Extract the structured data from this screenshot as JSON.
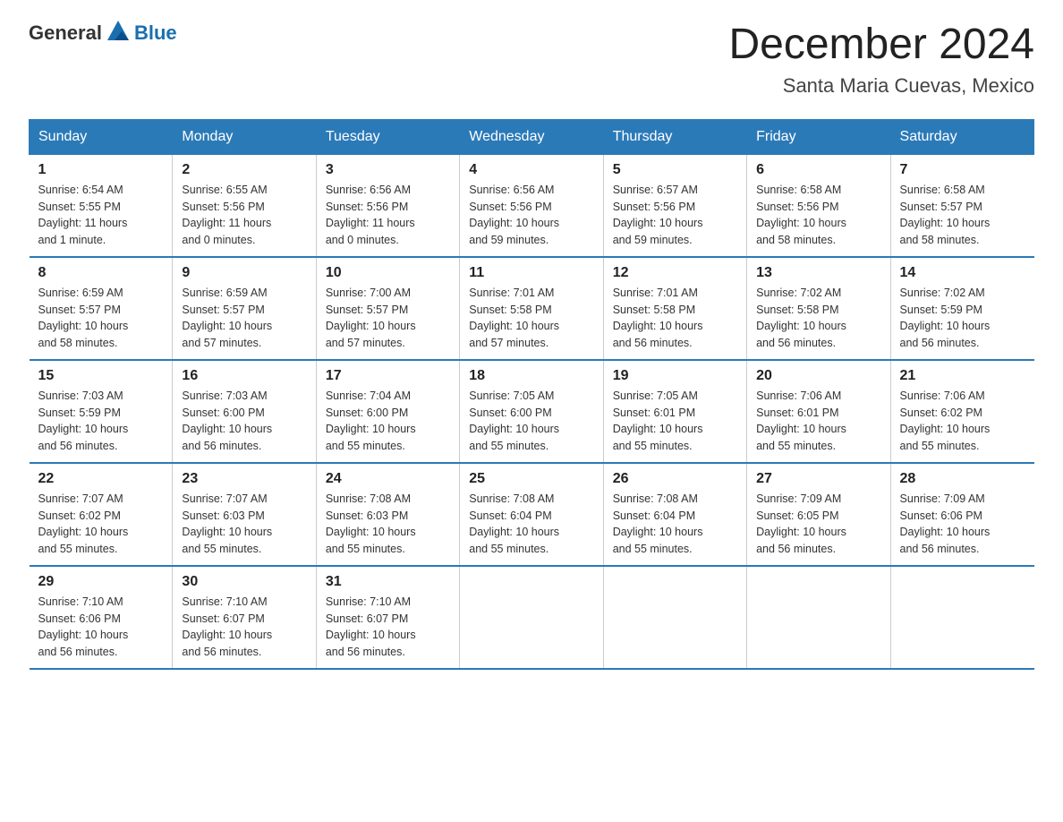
{
  "logo": {
    "general": "General",
    "blue": "Blue"
  },
  "title": "December 2024",
  "location": "Santa Maria Cuevas, Mexico",
  "days_header": [
    "Sunday",
    "Monday",
    "Tuesday",
    "Wednesday",
    "Thursday",
    "Friday",
    "Saturday"
  ],
  "weeks": [
    [
      {
        "day": "1",
        "sunrise": "6:54 AM",
        "sunset": "5:55 PM",
        "daylight": "11 hours and 1 minute."
      },
      {
        "day": "2",
        "sunrise": "6:55 AM",
        "sunset": "5:56 PM",
        "daylight": "11 hours and 0 minutes."
      },
      {
        "day": "3",
        "sunrise": "6:56 AM",
        "sunset": "5:56 PM",
        "daylight": "11 hours and 0 minutes."
      },
      {
        "day": "4",
        "sunrise": "6:56 AM",
        "sunset": "5:56 PM",
        "daylight": "10 hours and 59 minutes."
      },
      {
        "day": "5",
        "sunrise": "6:57 AM",
        "sunset": "5:56 PM",
        "daylight": "10 hours and 59 minutes."
      },
      {
        "day": "6",
        "sunrise": "6:58 AM",
        "sunset": "5:56 PM",
        "daylight": "10 hours and 58 minutes."
      },
      {
        "day": "7",
        "sunrise": "6:58 AM",
        "sunset": "5:57 PM",
        "daylight": "10 hours and 58 minutes."
      }
    ],
    [
      {
        "day": "8",
        "sunrise": "6:59 AM",
        "sunset": "5:57 PM",
        "daylight": "10 hours and 58 minutes."
      },
      {
        "day": "9",
        "sunrise": "6:59 AM",
        "sunset": "5:57 PM",
        "daylight": "10 hours and 57 minutes."
      },
      {
        "day": "10",
        "sunrise": "7:00 AM",
        "sunset": "5:57 PM",
        "daylight": "10 hours and 57 minutes."
      },
      {
        "day": "11",
        "sunrise": "7:01 AM",
        "sunset": "5:58 PM",
        "daylight": "10 hours and 57 minutes."
      },
      {
        "day": "12",
        "sunrise": "7:01 AM",
        "sunset": "5:58 PM",
        "daylight": "10 hours and 56 minutes."
      },
      {
        "day": "13",
        "sunrise": "7:02 AM",
        "sunset": "5:58 PM",
        "daylight": "10 hours and 56 minutes."
      },
      {
        "day": "14",
        "sunrise": "7:02 AM",
        "sunset": "5:59 PM",
        "daylight": "10 hours and 56 minutes."
      }
    ],
    [
      {
        "day": "15",
        "sunrise": "7:03 AM",
        "sunset": "5:59 PM",
        "daylight": "10 hours and 56 minutes."
      },
      {
        "day": "16",
        "sunrise": "7:03 AM",
        "sunset": "6:00 PM",
        "daylight": "10 hours and 56 minutes."
      },
      {
        "day": "17",
        "sunrise": "7:04 AM",
        "sunset": "6:00 PM",
        "daylight": "10 hours and 55 minutes."
      },
      {
        "day": "18",
        "sunrise": "7:05 AM",
        "sunset": "6:00 PM",
        "daylight": "10 hours and 55 minutes."
      },
      {
        "day": "19",
        "sunrise": "7:05 AM",
        "sunset": "6:01 PM",
        "daylight": "10 hours and 55 minutes."
      },
      {
        "day": "20",
        "sunrise": "7:06 AM",
        "sunset": "6:01 PM",
        "daylight": "10 hours and 55 minutes."
      },
      {
        "day": "21",
        "sunrise": "7:06 AM",
        "sunset": "6:02 PM",
        "daylight": "10 hours and 55 minutes."
      }
    ],
    [
      {
        "day": "22",
        "sunrise": "7:07 AM",
        "sunset": "6:02 PM",
        "daylight": "10 hours and 55 minutes."
      },
      {
        "day": "23",
        "sunrise": "7:07 AM",
        "sunset": "6:03 PM",
        "daylight": "10 hours and 55 minutes."
      },
      {
        "day": "24",
        "sunrise": "7:08 AM",
        "sunset": "6:03 PM",
        "daylight": "10 hours and 55 minutes."
      },
      {
        "day": "25",
        "sunrise": "7:08 AM",
        "sunset": "6:04 PM",
        "daylight": "10 hours and 55 minutes."
      },
      {
        "day": "26",
        "sunrise": "7:08 AM",
        "sunset": "6:04 PM",
        "daylight": "10 hours and 55 minutes."
      },
      {
        "day": "27",
        "sunrise": "7:09 AM",
        "sunset": "6:05 PM",
        "daylight": "10 hours and 56 minutes."
      },
      {
        "day": "28",
        "sunrise": "7:09 AM",
        "sunset": "6:06 PM",
        "daylight": "10 hours and 56 minutes."
      }
    ],
    [
      {
        "day": "29",
        "sunrise": "7:10 AM",
        "sunset": "6:06 PM",
        "daylight": "10 hours and 56 minutes."
      },
      {
        "day": "30",
        "sunrise": "7:10 AM",
        "sunset": "6:07 PM",
        "daylight": "10 hours and 56 minutes."
      },
      {
        "day": "31",
        "sunrise": "7:10 AM",
        "sunset": "6:07 PM",
        "daylight": "10 hours and 56 minutes."
      },
      null,
      null,
      null,
      null
    ]
  ]
}
